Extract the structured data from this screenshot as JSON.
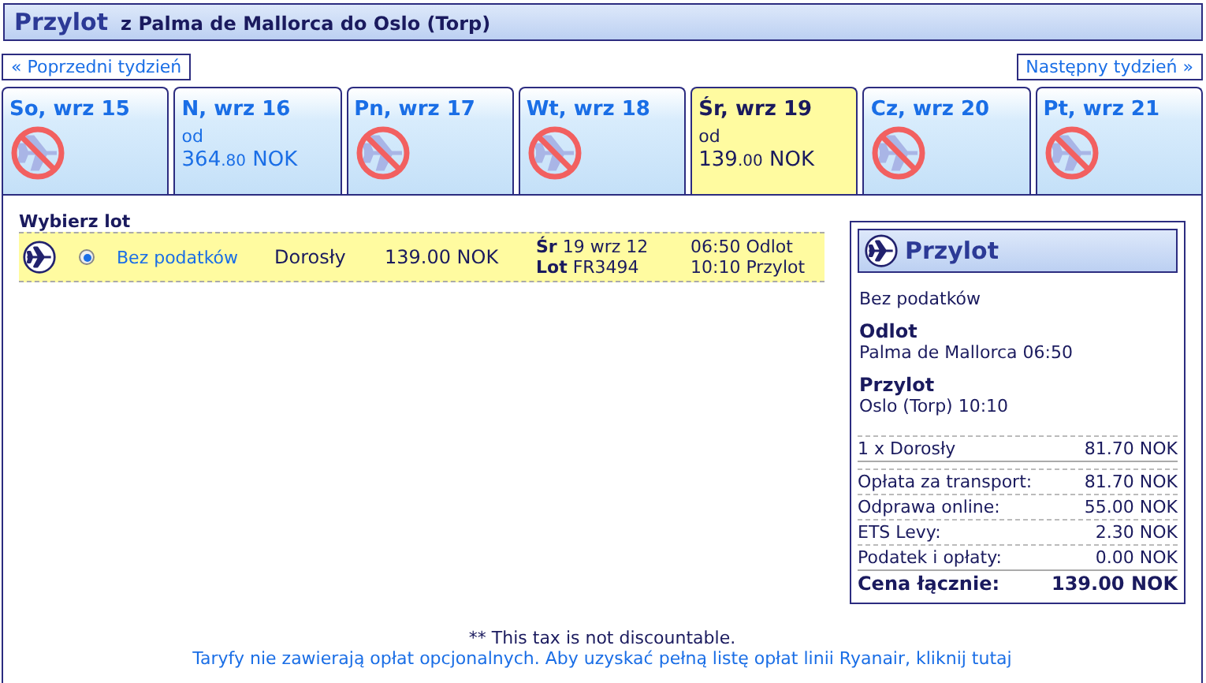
{
  "header": {
    "title": "Przylot",
    "route": "z Palma de Mallorca do Oslo (Torp)"
  },
  "nav": {
    "prev": "« Poprzedni tydzień",
    "next": "Następny tydzień »"
  },
  "days": [
    {
      "label": "So, wrz 15",
      "kind": "none",
      "selected": false
    },
    {
      "label": "N, wrz 16",
      "kind": "price",
      "from": "od",
      "amount": "364",
      "cents": ".80",
      "currency": "NOK",
      "selected": false
    },
    {
      "label": "Pn, wrz 17",
      "kind": "none",
      "selected": false
    },
    {
      "label": "Wt, wrz 18",
      "kind": "none",
      "selected": false
    },
    {
      "label": "Śr, wrz 19",
      "kind": "price",
      "from": "od",
      "amount": "139",
      "cents": ".00",
      "currency": "NOK",
      "selected": true
    },
    {
      "label": "Cz, wrz 20",
      "kind": "none",
      "selected": false
    },
    {
      "label": "Pt, wrz 21",
      "kind": "none",
      "selected": false
    }
  ],
  "flights": {
    "heading": "Wybierz lot",
    "rows": [
      {
        "fare": "Bez podatków",
        "passenger": "Dorosły",
        "price": "139.00 NOK",
        "date": "**Śr** 19 wrz 12",
        "flight": "**Lot** FR3494",
        "depart": "06:50 Odlot",
        "arrive": "10:10 Przylot",
        "selected": true
      }
    ]
  },
  "summary": {
    "title": "Przylot",
    "fare": "Bez podatków",
    "legs": [
      {
        "label": "Odlot",
        "detail": "Palma de Mallorca 06:50"
      },
      {
        "label": "Przylot",
        "detail": "Oslo (Torp) 10:10"
      }
    ],
    "passengers": [
      {
        "label": "1 x Dorosły",
        "value": "81.70 NOK"
      }
    ],
    "fees": [
      {
        "label": "Opłata za transport:",
        "value": "81.70 NOK"
      },
      {
        "label": "Odprawa online:",
        "value": "55.00 NOK"
      },
      {
        "label": "ETS Levy:",
        "value": "2.30 NOK"
      },
      {
        "label": "Podatek i opłaty:",
        "value": "0.00 NOK"
      }
    ],
    "total": {
      "label": "Cena łącznie:",
      "value": "139.00 NOK"
    }
  },
  "footer": {
    "note": "** This tax is not discountable.",
    "link": "Taryfy nie zawierają opłat opcjonalnych. Aby uzyskać pełną listę opłat linii Ryanair, kliknij tutaj"
  }
}
